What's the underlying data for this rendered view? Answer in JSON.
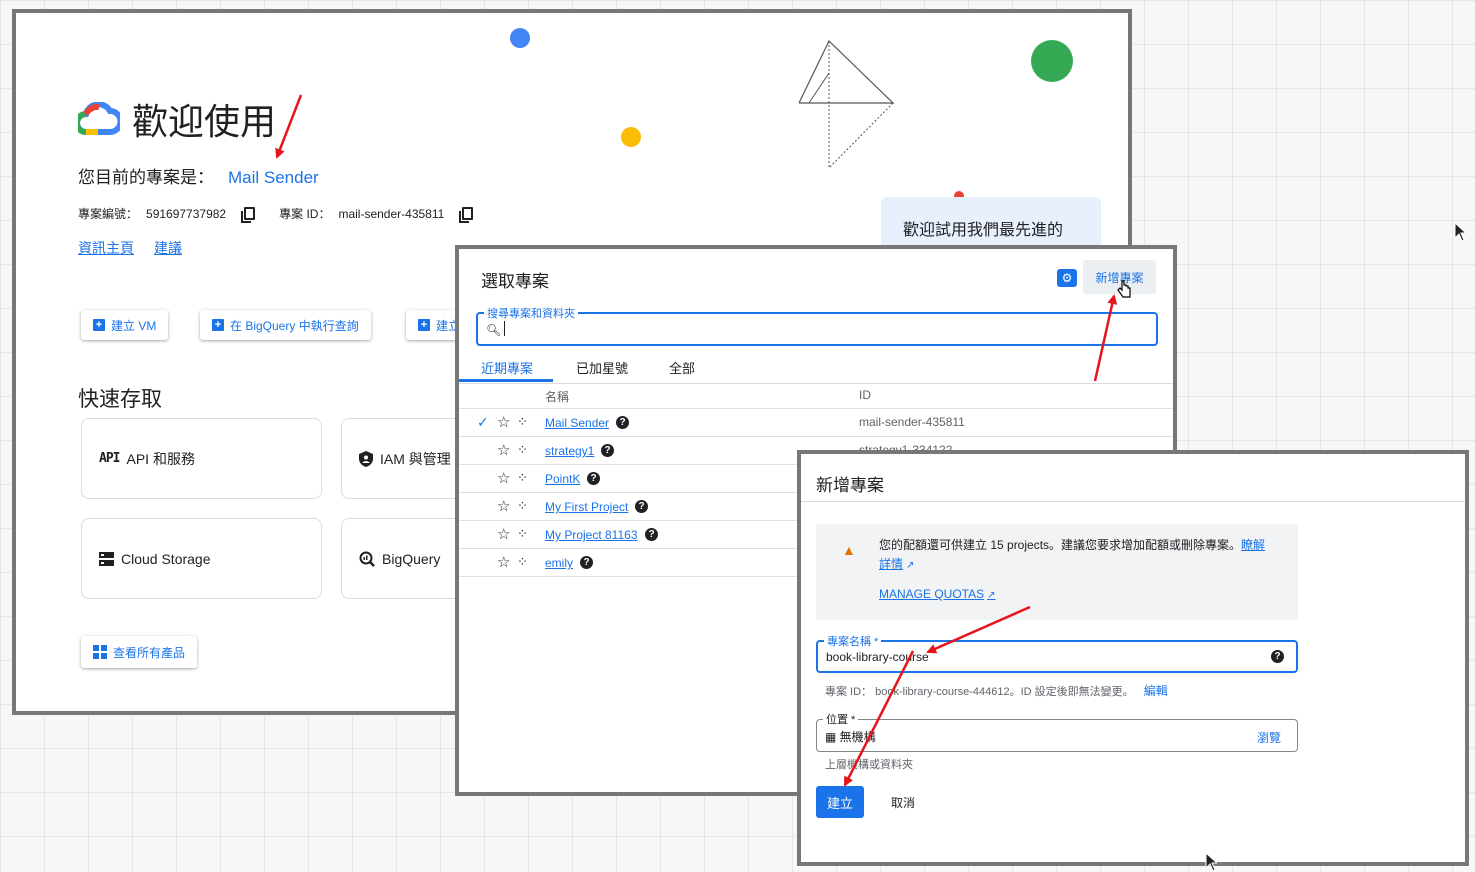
{
  "welcome": {
    "title": "歡迎使用",
    "current_project_label": "您目前的專案是：",
    "current_project_name": "Mail Sender",
    "project_number_label": "專案編號：",
    "project_number": "591697737982",
    "project_id_label": "專案 ID：",
    "project_id": "mail-sender-435811",
    "link_dashboard": "資訊主頁",
    "link_recommendations": "建議",
    "actions": [
      "建立 VM",
      "在 BigQuery 中執行查詢",
      "建立"
    ],
    "quick_access_title": "快速存取",
    "quick_access": [
      {
        "icon_text": "API",
        "label": "API 和服務"
      },
      {
        "icon": "shield-icon",
        "label": "IAM 與管理"
      },
      {
        "icon": "storage-icon",
        "label": "Cloud Storage"
      },
      {
        "icon": "bigquery-icon",
        "label": "BigQuery"
      }
    ],
    "view_all_products": "查看所有產品",
    "promo_text": "歡迎試用我們最先進的"
  },
  "select_project": {
    "title": "選取專案",
    "new_project_button": "新增專案",
    "search_label": "搜尋專案和資料夾",
    "tabs": [
      "近期專案",
      "已加星號",
      "全部"
    ],
    "columns": {
      "name": "名稱",
      "id": "ID"
    },
    "rows": [
      {
        "name": "Mail Sender",
        "id": "mail-sender-435811",
        "selected": true
      },
      {
        "name": "strategy1",
        "id": "strategy1-334122",
        "selected": false
      },
      {
        "name": "PointK",
        "id": "",
        "selected": false
      },
      {
        "name": "My First Project",
        "id": "",
        "selected": false
      },
      {
        "name": "My Project 81163",
        "id": "",
        "selected": false
      },
      {
        "name": "emily",
        "id": "",
        "selected": false
      }
    ]
  },
  "new_project": {
    "title": "新增專案",
    "quota_text_1": "您的配額還可供建立 15 projects。建議您要求增加配額或刪除專案。",
    "quota_link_1": "瞭解",
    "quota_link_2": "詳情",
    "manage_quotas": "MANAGE QUOTAS",
    "name_label": "專案名稱 *",
    "name_value": "book-library-course",
    "id_hint": "專案 ID： book-library-course-444612。ID 設定後即無法變更。",
    "edit": "編輯",
    "location_label": "位置 *",
    "location_value": "無機構",
    "browse": "瀏覽",
    "location_hint": "上層機構或資料夾",
    "create": "建立",
    "cancel": "取消"
  },
  "colors": {
    "accent": "#1a73e8",
    "annotation_arrow": "#e8141b",
    "warning": "#e37400",
    "panel_border": "#777777"
  }
}
